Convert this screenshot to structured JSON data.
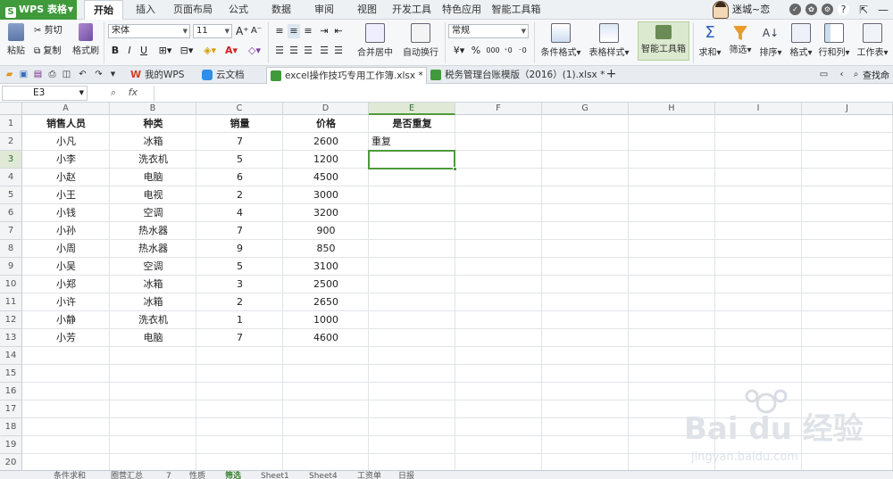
{
  "app": {
    "logo_text": "WPS 表格",
    "logo_mark": "S"
  },
  "menu_tabs": [
    "开始",
    "插入",
    "页面布局",
    "公式",
    "数据",
    "审阅",
    "视图",
    "开发工具",
    "特色应用",
    "智能工具箱"
  ],
  "user": {
    "name": "迷城~恋"
  },
  "ribbon": {
    "paste": "粘贴",
    "cut": "剪切",
    "copy": "复制",
    "format_painter": "格式刷",
    "font_name": "宋体",
    "font_size": "11",
    "bold": "B",
    "italic": "I",
    "underline": "U",
    "merge_center": "合并居中",
    "wrap_text": "自动换行",
    "number_format": "常规",
    "currency": "¥",
    "percent": "%",
    "thousands": "000",
    "cond_format": "条件格式",
    "table_style": "表格样式",
    "smart_toolbox": "智能工具箱",
    "sum": "求和",
    "filter": "筛选",
    "sort": "排序",
    "format": "格式",
    "row_col": "行和列",
    "worksheet": "工作表"
  },
  "doc_tabs": [
    {
      "label": "我的WPS",
      "active": false
    },
    {
      "label": "云文档",
      "active": false
    },
    {
      "label": "excel操作技巧专用工作簿.xlsx *",
      "active": true
    },
    {
      "label": "税务管理台账模版（2016）(1).xlsx *",
      "active": false
    }
  ],
  "search_label": "查找命",
  "formula_bar": {
    "cell_ref": "E3",
    "fx": "fx",
    "value": ""
  },
  "columns": [
    "A",
    "B",
    "C",
    "D",
    "E",
    "F",
    "G",
    "H",
    "I",
    "J"
  ],
  "selected_column": "E",
  "rows": [
    "1",
    "2",
    "3",
    "4",
    "5",
    "6",
    "7",
    "8",
    "9",
    "10",
    "11",
    "12",
    "13",
    "14",
    "15",
    "16",
    "17",
    "18",
    "19",
    "20"
  ],
  "selected_row": "3",
  "table": {
    "headers": [
      "销售人员",
      "种类",
      "销量",
      "价格",
      "是否重复"
    ],
    "data": [
      [
        "小凡",
        "冰箱",
        "7",
        "2600",
        "重复"
      ],
      [
        "小李",
        "洗衣机",
        "5",
        "1200",
        ""
      ],
      [
        "小赵",
        "电脑",
        "6",
        "4500",
        ""
      ],
      [
        "小王",
        "电视",
        "2",
        "3000",
        ""
      ],
      [
        "小钱",
        "空调",
        "4",
        "3200",
        ""
      ],
      [
        "小孙",
        "热水器",
        "7",
        "900",
        ""
      ],
      [
        "小周",
        "热水器",
        "9",
        "850",
        ""
      ],
      [
        "小吴",
        "空调",
        "5",
        "3100",
        ""
      ],
      [
        "小郑",
        "冰箱",
        "3",
        "2500",
        ""
      ],
      [
        "小许",
        "冰箱",
        "2",
        "2650",
        ""
      ],
      [
        "小静",
        "洗衣机",
        "1",
        "1000",
        ""
      ],
      [
        "小芳",
        "电脑",
        "7",
        "4600",
        ""
      ]
    ]
  },
  "sheet_tabs": [
    "条件求和",
    "圈营汇总",
    "7",
    "性质",
    "筛选",
    "Sheet1",
    "Sheet4",
    "工资单",
    "日报"
  ],
  "active_sheet": "筛选",
  "watermark": {
    "text": "Bai du 经验",
    "sub": "jingyan.baidu.com"
  },
  "colors": {
    "accent": "#4d9a3c",
    "brand": "#3e9a3a"
  }
}
